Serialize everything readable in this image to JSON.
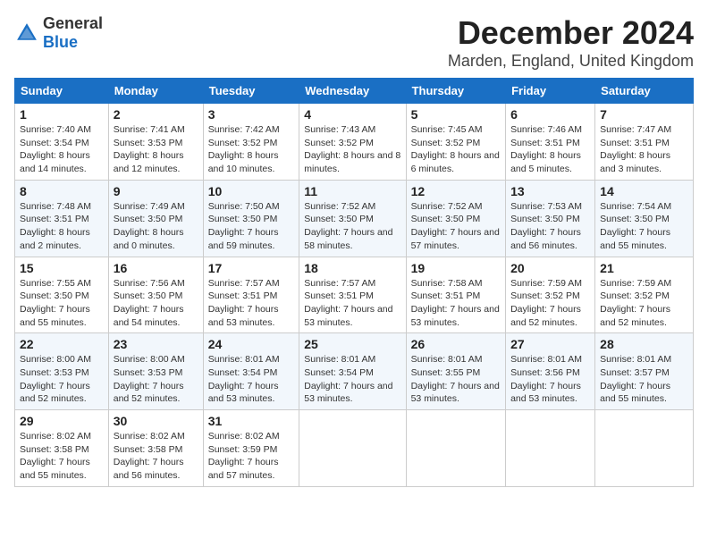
{
  "logo": {
    "general": "General",
    "blue": "Blue"
  },
  "title": "December 2024",
  "location": "Marden, England, United Kingdom",
  "weekdays": [
    "Sunday",
    "Monday",
    "Tuesday",
    "Wednesday",
    "Thursday",
    "Friday",
    "Saturday"
  ],
  "weeks": [
    [
      {
        "day": "1",
        "sunrise": "Sunrise: 7:40 AM",
        "sunset": "Sunset: 3:54 PM",
        "daylight": "Daylight: 8 hours and 14 minutes."
      },
      {
        "day": "2",
        "sunrise": "Sunrise: 7:41 AM",
        "sunset": "Sunset: 3:53 PM",
        "daylight": "Daylight: 8 hours and 12 minutes."
      },
      {
        "day": "3",
        "sunrise": "Sunrise: 7:42 AM",
        "sunset": "Sunset: 3:52 PM",
        "daylight": "Daylight: 8 hours and 10 minutes."
      },
      {
        "day": "4",
        "sunrise": "Sunrise: 7:43 AM",
        "sunset": "Sunset: 3:52 PM",
        "daylight": "Daylight: 8 hours and 8 minutes."
      },
      {
        "day": "5",
        "sunrise": "Sunrise: 7:45 AM",
        "sunset": "Sunset: 3:52 PM",
        "daylight": "Daylight: 8 hours and 6 minutes."
      },
      {
        "day": "6",
        "sunrise": "Sunrise: 7:46 AM",
        "sunset": "Sunset: 3:51 PM",
        "daylight": "Daylight: 8 hours and 5 minutes."
      },
      {
        "day": "7",
        "sunrise": "Sunrise: 7:47 AM",
        "sunset": "Sunset: 3:51 PM",
        "daylight": "Daylight: 8 hours and 3 minutes."
      }
    ],
    [
      {
        "day": "8",
        "sunrise": "Sunrise: 7:48 AM",
        "sunset": "Sunset: 3:51 PM",
        "daylight": "Daylight: 8 hours and 2 minutes."
      },
      {
        "day": "9",
        "sunrise": "Sunrise: 7:49 AM",
        "sunset": "Sunset: 3:50 PM",
        "daylight": "Daylight: 8 hours and 0 minutes."
      },
      {
        "day": "10",
        "sunrise": "Sunrise: 7:50 AM",
        "sunset": "Sunset: 3:50 PM",
        "daylight": "Daylight: 7 hours and 59 minutes."
      },
      {
        "day": "11",
        "sunrise": "Sunrise: 7:52 AM",
        "sunset": "Sunset: 3:50 PM",
        "daylight": "Daylight: 7 hours and 58 minutes."
      },
      {
        "day": "12",
        "sunrise": "Sunrise: 7:52 AM",
        "sunset": "Sunset: 3:50 PM",
        "daylight": "Daylight: 7 hours and 57 minutes."
      },
      {
        "day": "13",
        "sunrise": "Sunrise: 7:53 AM",
        "sunset": "Sunset: 3:50 PM",
        "daylight": "Daylight: 7 hours and 56 minutes."
      },
      {
        "day": "14",
        "sunrise": "Sunrise: 7:54 AM",
        "sunset": "Sunset: 3:50 PM",
        "daylight": "Daylight: 7 hours and 55 minutes."
      }
    ],
    [
      {
        "day": "15",
        "sunrise": "Sunrise: 7:55 AM",
        "sunset": "Sunset: 3:50 PM",
        "daylight": "Daylight: 7 hours and 55 minutes."
      },
      {
        "day": "16",
        "sunrise": "Sunrise: 7:56 AM",
        "sunset": "Sunset: 3:50 PM",
        "daylight": "Daylight: 7 hours and 54 minutes."
      },
      {
        "day": "17",
        "sunrise": "Sunrise: 7:57 AM",
        "sunset": "Sunset: 3:51 PM",
        "daylight": "Daylight: 7 hours and 53 minutes."
      },
      {
        "day": "18",
        "sunrise": "Sunrise: 7:57 AM",
        "sunset": "Sunset: 3:51 PM",
        "daylight": "Daylight: 7 hours and 53 minutes."
      },
      {
        "day": "19",
        "sunrise": "Sunrise: 7:58 AM",
        "sunset": "Sunset: 3:51 PM",
        "daylight": "Daylight: 7 hours and 53 minutes."
      },
      {
        "day": "20",
        "sunrise": "Sunrise: 7:59 AM",
        "sunset": "Sunset: 3:52 PM",
        "daylight": "Daylight: 7 hours and 52 minutes."
      },
      {
        "day": "21",
        "sunrise": "Sunrise: 7:59 AM",
        "sunset": "Sunset: 3:52 PM",
        "daylight": "Daylight: 7 hours and 52 minutes."
      }
    ],
    [
      {
        "day": "22",
        "sunrise": "Sunrise: 8:00 AM",
        "sunset": "Sunset: 3:53 PM",
        "daylight": "Daylight: 7 hours and 52 minutes."
      },
      {
        "day": "23",
        "sunrise": "Sunrise: 8:00 AM",
        "sunset": "Sunset: 3:53 PM",
        "daylight": "Daylight: 7 hours and 52 minutes."
      },
      {
        "day": "24",
        "sunrise": "Sunrise: 8:01 AM",
        "sunset": "Sunset: 3:54 PM",
        "daylight": "Daylight: 7 hours and 53 minutes."
      },
      {
        "day": "25",
        "sunrise": "Sunrise: 8:01 AM",
        "sunset": "Sunset: 3:54 PM",
        "daylight": "Daylight: 7 hours and 53 minutes."
      },
      {
        "day": "26",
        "sunrise": "Sunrise: 8:01 AM",
        "sunset": "Sunset: 3:55 PM",
        "daylight": "Daylight: 7 hours and 53 minutes."
      },
      {
        "day": "27",
        "sunrise": "Sunrise: 8:01 AM",
        "sunset": "Sunset: 3:56 PM",
        "daylight": "Daylight: 7 hours and 53 minutes."
      },
      {
        "day": "28",
        "sunrise": "Sunrise: 8:01 AM",
        "sunset": "Sunset: 3:57 PM",
        "daylight": "Daylight: 7 hours and 55 minutes."
      }
    ],
    [
      {
        "day": "29",
        "sunrise": "Sunrise: 8:02 AM",
        "sunset": "Sunset: 3:58 PM",
        "daylight": "Daylight: 7 hours and 55 minutes."
      },
      {
        "day": "30",
        "sunrise": "Sunrise: 8:02 AM",
        "sunset": "Sunset: 3:58 PM",
        "daylight": "Daylight: 7 hours and 56 minutes."
      },
      {
        "day": "31",
        "sunrise": "Sunrise: 8:02 AM",
        "sunset": "Sunset: 3:59 PM",
        "daylight": "Daylight: 7 hours and 57 minutes."
      },
      null,
      null,
      null,
      null
    ]
  ]
}
